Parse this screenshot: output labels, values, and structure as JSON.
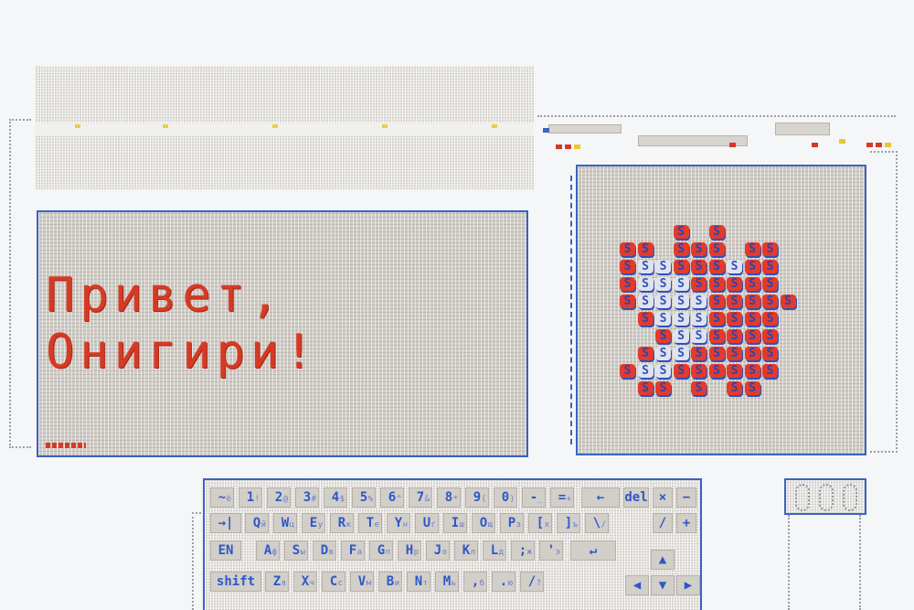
{
  "screen": {
    "greeting_line1": "Привет,",
    "greeting_line2": "Онигири!"
  },
  "onigiri": {
    "glyph": "S",
    "alt_glyph": "S",
    "colors": {
      "red": "#e23a2c",
      "blue": "#3553b8",
      "frame": "#3b62c4"
    },
    "rows": [
      "...R.R....",
      "RR.RRR.RR.",
      "RBBRRRBRR.",
      "RBBBRRRRR.",
      "RBBBBRRRRR",
      ".RBBBRRRR.",
      "..RBBRRRR.",
      ".RBBRRRRR.",
      "RBBRRRRRR.",
      ".RR.R.RR.."
    ]
  },
  "keyboard": {
    "row1": [
      {
        "label": "~",
        "sub": "ё"
      },
      {
        "label": "1",
        "sub": "!"
      },
      {
        "label": "2",
        "sub": "@"
      },
      {
        "label": "3",
        "sub": "#"
      },
      {
        "label": "4",
        "sub": "$"
      },
      {
        "label": "5",
        "sub": "%"
      },
      {
        "label": "6",
        "sub": "^"
      },
      {
        "label": "7",
        "sub": "&"
      },
      {
        "label": "8",
        "sub": "*"
      },
      {
        "label": "9",
        "sub": "("
      },
      {
        "label": "0",
        "sub": ")"
      },
      {
        "label": "-",
        "sub": "_"
      },
      {
        "label": "=",
        "sub": "+"
      }
    ],
    "backspace": "←",
    "del": "del",
    "times": "×",
    "minus": "−",
    "tab": "→|",
    "row2": [
      {
        "label": "Q",
        "sub": "й"
      },
      {
        "label": "W",
        "sub": "ц"
      },
      {
        "label": "E",
        "sub": "у"
      },
      {
        "label": "R",
        "sub": "к"
      },
      {
        "label": "T",
        "sub": "е"
      },
      {
        "label": "Y",
        "sub": "н"
      },
      {
        "label": "U",
        "sub": "г"
      },
      {
        "label": "I",
        "sub": "ш"
      },
      {
        "label": "O",
        "sub": "щ"
      },
      {
        "label": "P",
        "sub": "з"
      },
      {
        "label": "[",
        "sub": "х"
      },
      {
        "label": "]",
        "sub": "ъ"
      },
      {
        "label": "\\",
        "sub": "/"
      }
    ],
    "divide": "/",
    "plus": "+",
    "lang": "EN",
    "row3": [
      {
        "label": "A",
        "sub": "ф"
      },
      {
        "label": "S",
        "sub": "ы"
      },
      {
        "label": "D",
        "sub": "в"
      },
      {
        "label": "F",
        "sub": "а"
      },
      {
        "label": "G",
        "sub": "п"
      },
      {
        "label": "H",
        "sub": "р"
      },
      {
        "label": "J",
        "sub": "о"
      },
      {
        "label": "K",
        "sub": "л"
      },
      {
        "label": "L",
        "sub": "д"
      },
      {
        "label": ";",
        "sub": "ж"
      },
      {
        "label": "'",
        "sub": "э"
      }
    ],
    "enter": "↵",
    "up": "▲",
    "shift": "shift",
    "row4": [
      {
        "label": "Z",
        "sub": "я"
      },
      {
        "label": "X",
        "sub": "ч"
      },
      {
        "label": "C",
        "sub": "с"
      },
      {
        "label": "V",
        "sub": "м"
      },
      {
        "label": "B",
        "sub": "и"
      },
      {
        "label": "N",
        "sub": "т"
      },
      {
        "label": "M",
        "sub": "ь"
      },
      {
        "label": ",",
        "sub": "б"
      },
      {
        "label": ".",
        "sub": "ю"
      },
      {
        "label": "/",
        "sub": "?"
      }
    ],
    "left": "◀",
    "down": "▼",
    "right": "▶"
  }
}
